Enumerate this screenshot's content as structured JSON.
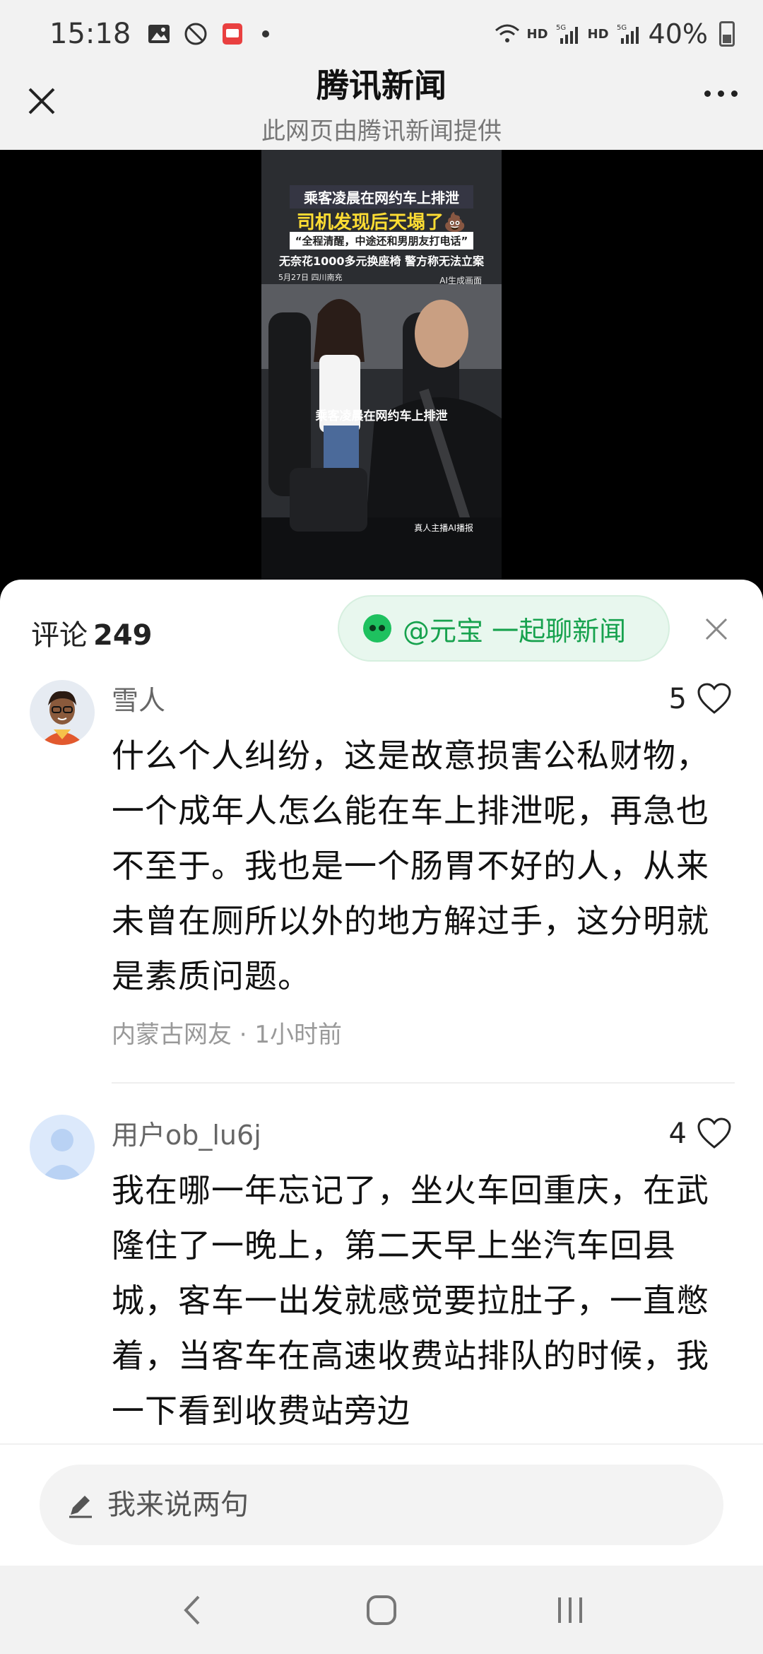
{
  "status_bar": {
    "time": "15:18",
    "hd1": "HD",
    "net1": "5G",
    "hd2": "HD",
    "net2": "5G",
    "battery": "40%"
  },
  "header": {
    "title": "腾讯新闻",
    "subtitle": "此网页由腾讯新闻提供"
  },
  "video": {
    "headline1": "乘客凌晨在网约车上排泄",
    "headline2": "司机发现后天塌了💩",
    "headline3": "“全程清醒，中途还和男朋友打电话”",
    "headline4": "无奈花1000多元换座椅 警方称无法立案",
    "meta": "5月27日 四川南充",
    "ai_label": "AI生成画面",
    "subtitle": "乘客凌晨在网约车上排泄",
    "host": "真人主播AI播报"
  },
  "comments_panel": {
    "label": "评论",
    "count": "249",
    "yuanbao": "@元宝 一起聊新闻",
    "items": [
      {
        "name": "雪人",
        "likes": "5",
        "text": "什么个人纠纷，这是故意损害公私财物，一个成年人怎么能在车上排泄呢，再急也不至于。我也是一个肠胃不好的人，从来未曾在厕所以外的地方解过手，这分明就是素质问题。",
        "meta": "内蒙古网友 · 1小时前"
      },
      {
        "name": "用户ob_lu6j",
        "likes": "4",
        "text": "我在哪一年忘记了，坐火车回重庆，在武隆住了一晚上，第二天早上坐汽车回县城，客车一出发就感觉要拉肚子，一直憋着，当客车在高速收费站排队的时候，我一下看到收费站旁边"
      }
    ]
  },
  "input": {
    "placeholder": "我来说两句"
  },
  "colors": {
    "accent_green": "#17a24e",
    "background_grey": "#f2f2f2"
  }
}
